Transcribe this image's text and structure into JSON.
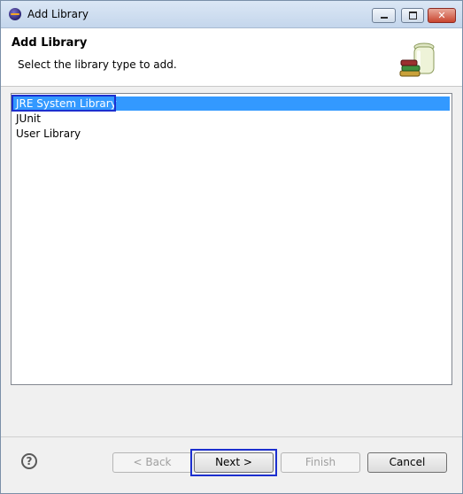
{
  "window": {
    "title": "Add Library"
  },
  "banner": {
    "title": "Add Library",
    "description": "Select the library type to add."
  },
  "library_types": [
    {
      "label": "JRE System Library",
      "selected": true
    },
    {
      "label": "JUnit",
      "selected": false
    },
    {
      "label": "User Library",
      "selected": false
    }
  ],
  "buttons": {
    "back": "< Back",
    "next": "Next >",
    "finish": "Finish",
    "cancel": "Cancel"
  },
  "help_symbol": "?",
  "colors": {
    "selection": "#3399ff",
    "highlight_outline": "#1c2fcf"
  },
  "icons": {
    "app": "eclipse-icon",
    "banner": "library-jar-books-icon",
    "help": "help-icon"
  }
}
